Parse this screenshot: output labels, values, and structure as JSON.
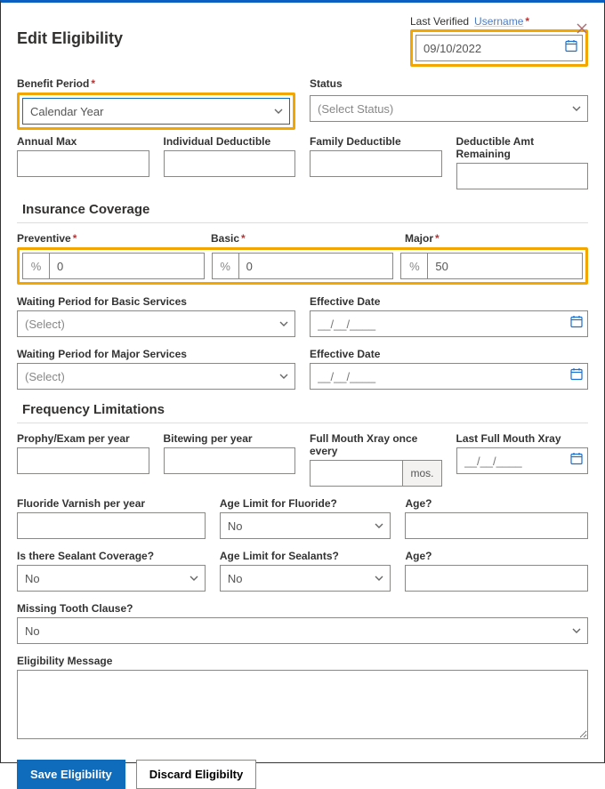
{
  "header": {
    "title": "Edit Eligibility",
    "last_verified_label": "Last Verified",
    "username": "Username",
    "date": "09/10/2022"
  },
  "benefit": {
    "period_label": "Benefit Period",
    "period_value": "Calendar Year",
    "status_label": "Status",
    "status_value": "(Select Status)",
    "annual_max_label": "Annual Max",
    "indiv_ded_label": "Individual Deductible",
    "family_ded_label": "Family Deductible",
    "ded_remain_label": "Deductible Amt Remaining"
  },
  "coverage": {
    "heading": "Insurance Coverage",
    "preventive_label": "Preventive",
    "preventive_value": "0",
    "basic_label": "Basic",
    "basic_value": "0",
    "major_label": "Major",
    "major_value": "50",
    "waiting_basic_label": "Waiting Period for Basic Services",
    "waiting_basic_value": "(Select)",
    "eff_date_label": "Effective Date",
    "eff_date_placeholder": "__/__/____",
    "waiting_major_label": "Waiting Period for Major Services",
    "waiting_major_value": "(Select)"
  },
  "freq": {
    "heading": "Frequency Limitations",
    "prophy_label": "Prophy/Exam per year",
    "bitewing_label": "Bitewing per year",
    "fullmouth_label": "Full Mouth Xray once every",
    "fullmouth_suffix": "mos.",
    "last_fullmouth_label": "Last Full Mouth Xray",
    "last_fullmouth_placeholder": "__/__/____",
    "fluoride_label": "Fluoride Varnish per year",
    "age_limit_fluoride_label": "Age Limit for Fluoride?",
    "age_limit_fluoride_value": "No",
    "age1_label": "Age?",
    "sealant_label": "Is there Sealant Coverage?",
    "sealant_value": "No",
    "age_limit_sealant_label": "Age Limit for Sealants?",
    "age_limit_sealant_value": "No",
    "age2_label": "Age?",
    "missing_tooth_label": "Missing Tooth Clause?",
    "missing_tooth_value": "No",
    "message_label": "Eligibility Message"
  },
  "buttons": {
    "save": "Save Eligibility",
    "discard": "Discard Eligibilty"
  },
  "glyphs": {
    "percent": "%",
    "asterisk": "*"
  }
}
